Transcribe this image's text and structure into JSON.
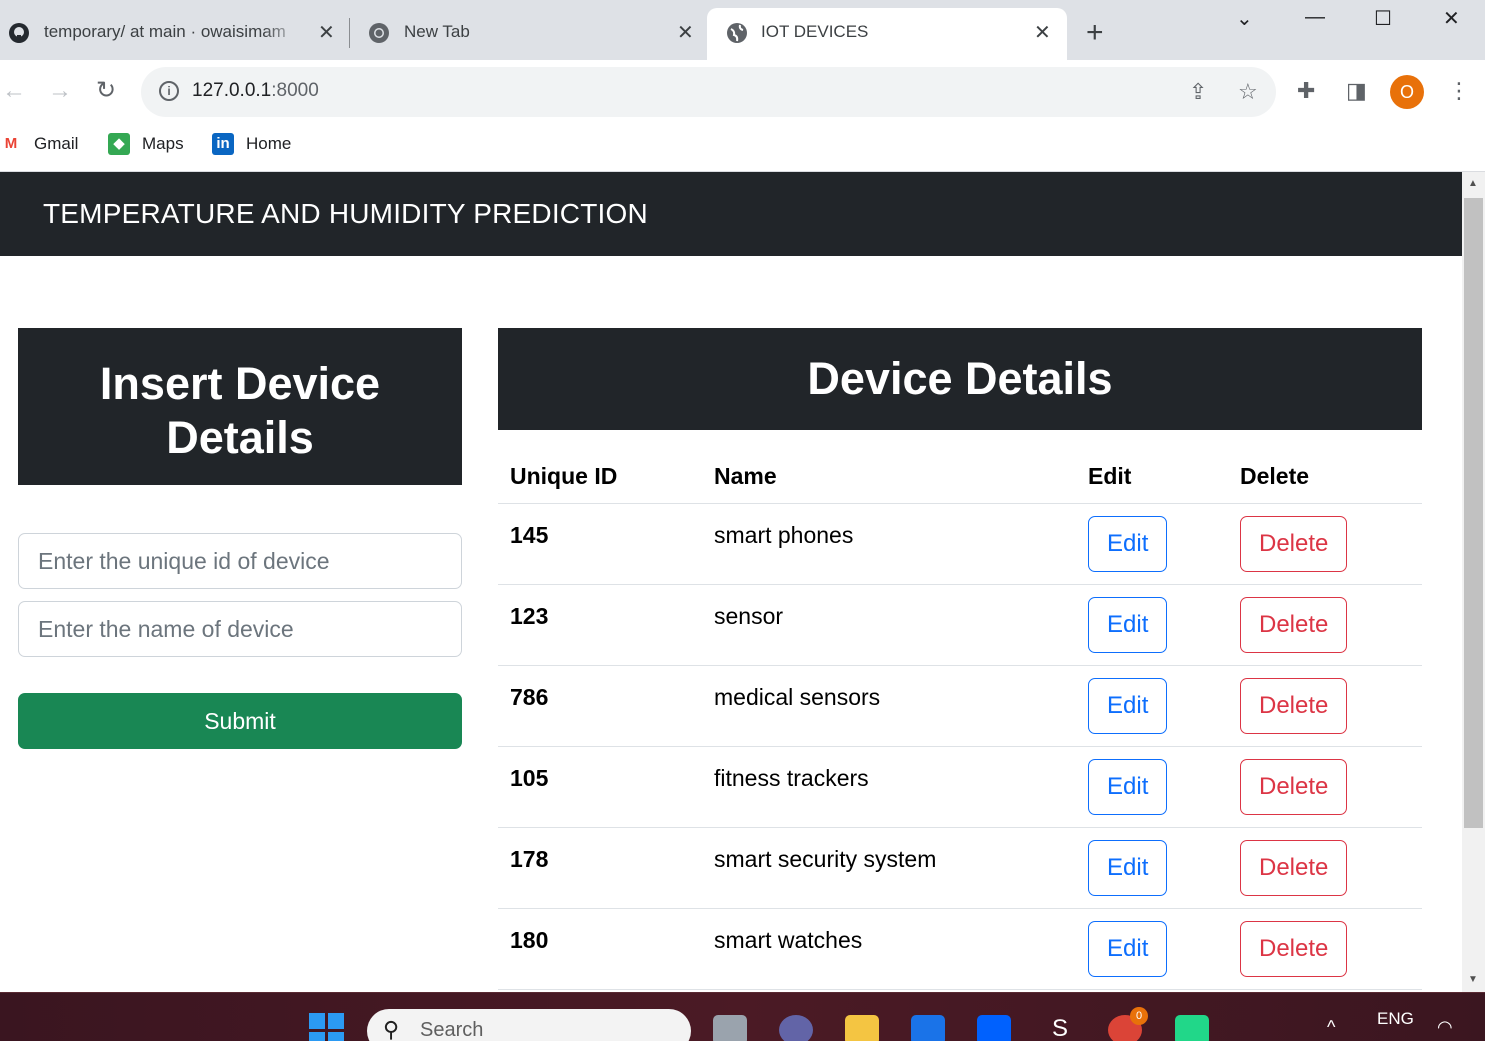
{
  "browser": {
    "tabs": [
      {
        "title": "temporary/ at main · owaisimam",
        "icon": "github-icon"
      },
      {
        "title": "New Tab",
        "icon": "chrome-icon"
      },
      {
        "title": "IOT DEVICES",
        "icon": "globe-icon",
        "active": true
      }
    ],
    "url_host": "127.0.0.1",
    "url_port": ":8000",
    "profile_initial": "O",
    "bookmarks": [
      {
        "label": "Gmail",
        "icon": "gmail-icon"
      },
      {
        "label": "Maps",
        "icon": "maps-icon"
      },
      {
        "label": "Home",
        "icon": "linkedin-icon"
      }
    ]
  },
  "page": {
    "brand": "TEMPERATURE AND HUMIDITY PREDICTION",
    "insert": {
      "title": "Insert Device Details",
      "id_placeholder": "Enter the unique id of device",
      "name_placeholder": "Enter the name of device",
      "submit_label": "Submit"
    },
    "details": {
      "title": "Device Details",
      "columns": [
        "Unique ID",
        "Name",
        "Edit",
        "Delete"
      ],
      "edit_label": "Edit",
      "delete_label": "Delete",
      "rows": [
        {
          "id": "145",
          "name": "smart phones"
        },
        {
          "id": "123",
          "name": "sensor"
        },
        {
          "id": "786",
          "name": "medical sensors"
        },
        {
          "id": "105",
          "name": "fitness trackers"
        },
        {
          "id": "178",
          "name": "smart security system"
        },
        {
          "id": "180",
          "name": "smart watches"
        }
      ]
    }
  },
  "taskbar": {
    "search_label": "Search",
    "language": "ENG",
    "chrome_badge": "0"
  },
  "colors": {
    "navbar": "#212529",
    "submit": "#198754",
    "edit": "#0d6efd",
    "delete": "#dc3545"
  }
}
